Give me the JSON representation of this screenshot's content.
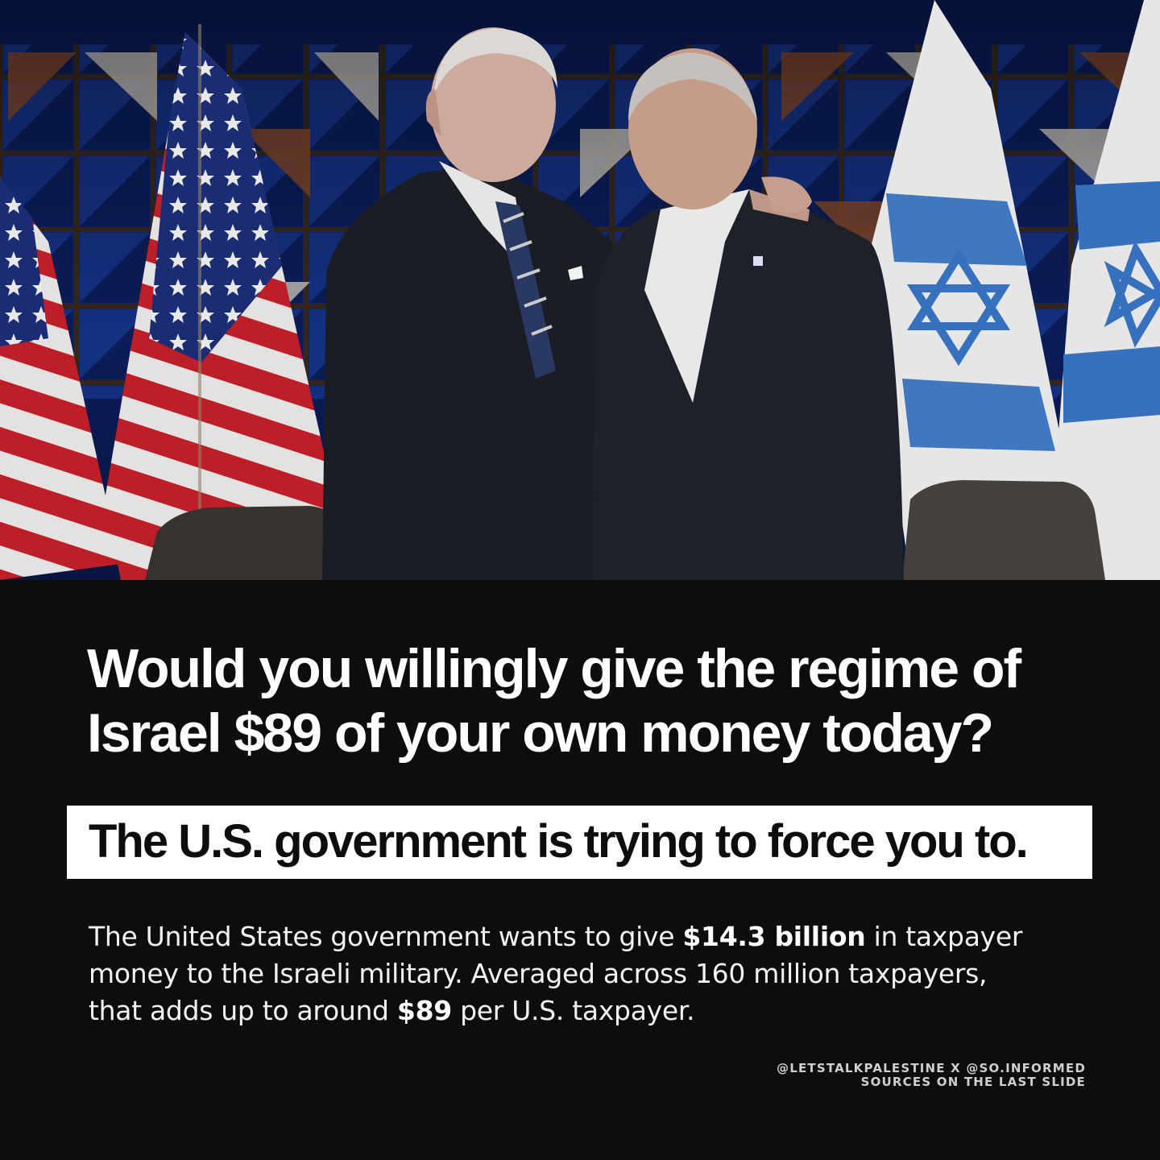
{
  "photo": {
    "alt_icon": "photo-of-two-men-with-flags-icon"
  },
  "headline": {
    "line1": "Would you willingly give the regime of",
    "line2": "Israel $89 of your own money today?"
  },
  "callout": {
    "text": "The U.S. government is trying to force you to."
  },
  "body": {
    "line1_pre": "The United States government wants to give ",
    "line1_bold": "$14.3 billion",
    "line1_post": " in taxpayer",
    "line2": "money to the Israeli military. Averaged across 160 million taxpayers,",
    "line3_pre": "that adds up to around ",
    "line3_bold": "$89",
    "line3_post": " per U.S. taxpayer."
  },
  "credits": {
    "line1": "@LETSTALKPALESTINE X @SO.INFORMED",
    "line2": "SOURCES ON THE LAST SLIDE"
  },
  "colors": {
    "background": "#0d0d0d",
    "text": "#ffffff",
    "callout_bg": "#ffffff",
    "callout_text": "#0d0d0d",
    "flag_blue": "#3a78c8",
    "flag_red": "#c8202a"
  }
}
